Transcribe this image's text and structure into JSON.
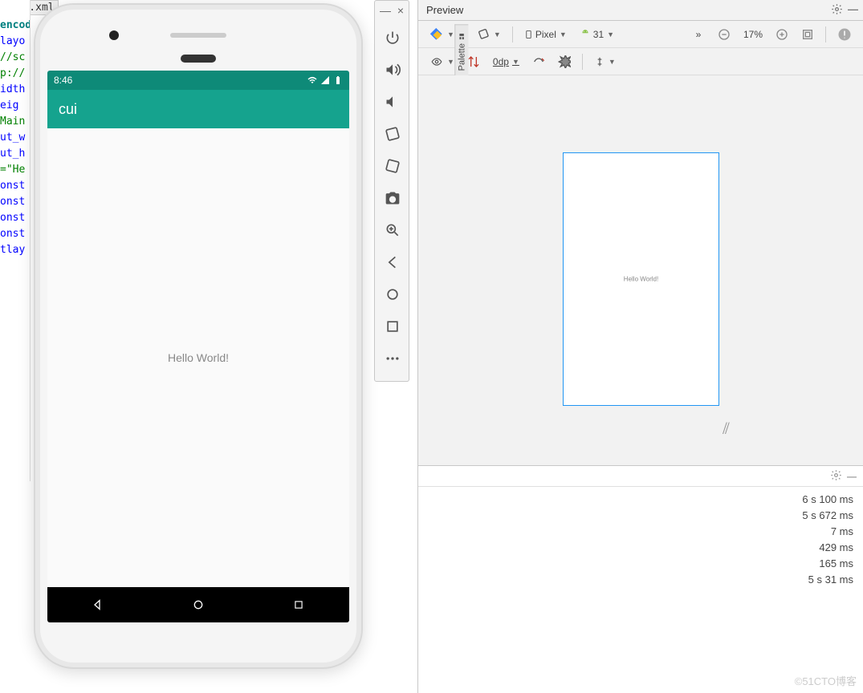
{
  "tab": {
    "file": "lors.xml"
  },
  "code_fragments": [
    "encod",
    "layo",
    "//sc",
    "p://",
    "idth",
    "eig",
    "Main",
    "",
    "",
    "ut_w",
    "ut_h",
    "=\"He",
    "onst",
    "onst",
    "onst",
    "onst",
    "",
    "tlay"
  ],
  "emulator": {
    "status_time": "8:46",
    "app_title": "cui",
    "body_text": "Hello World!",
    "win_min": "—",
    "win_close": "×"
  },
  "preview": {
    "title": "Preview",
    "device": "Pixel",
    "api": "31",
    "zoom": "17%",
    "margin": "0dp",
    "blueprint_text": "Hello World!",
    "palette_label": "Palette",
    "overflow": "»"
  },
  "log": {
    "lines": [
      "6 s 100 ms",
      "5 s 672 ms",
      "7 ms",
      "429 ms",
      "165 ms",
      "5 s 31 ms"
    ]
  },
  "watermark": "©51CTO博客"
}
